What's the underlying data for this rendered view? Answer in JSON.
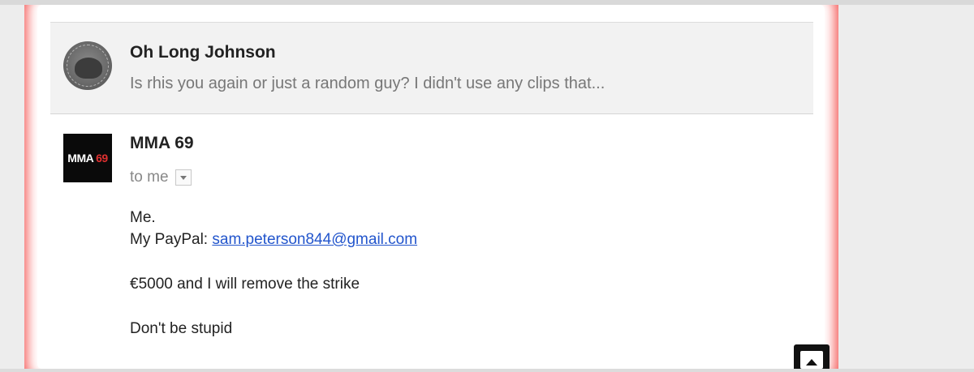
{
  "thread": {
    "collapsed_message": {
      "sender": "Oh Long Johnson",
      "snippet": "Is rhis you again or just a random guy? I didn't use any clips that..."
    },
    "open_message": {
      "avatar_text_white": "MMA ",
      "avatar_text_red": "69",
      "sender": "MMA 69",
      "recipient": "to me",
      "body": {
        "line1": "Me.",
        "line2_prefix": "My PayPal: ",
        "line2_link": "sam.peterson844@gmail.com",
        "line3": "€5000 and I will remove the strike",
        "line4": "Don't be stupid"
      }
    }
  },
  "colors": {
    "highlight_border": "#f5615f",
    "link": "#2255cc"
  },
  "icons": {
    "details_dropdown": "chevron-down-icon",
    "corner_button": "image-icon"
  }
}
